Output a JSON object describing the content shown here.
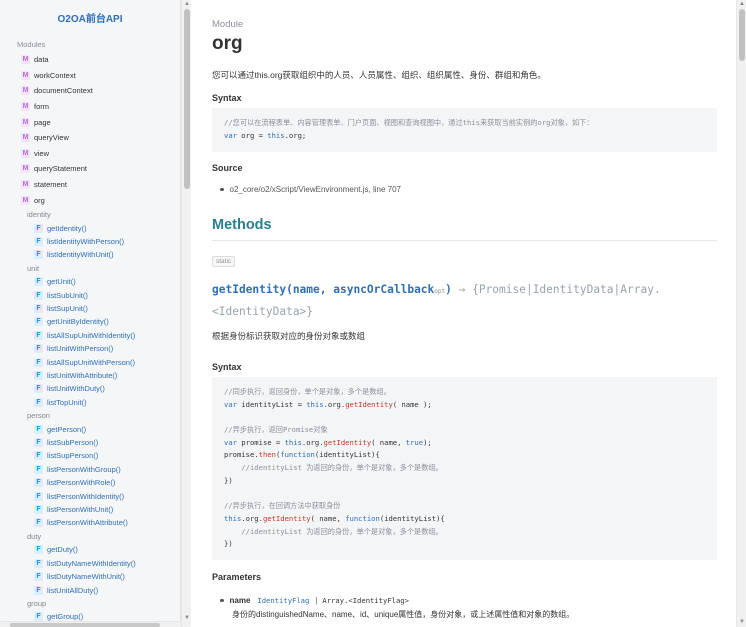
{
  "sidebar": {
    "title": "O2OA前台API",
    "modules_heading": "Modules",
    "modules": [
      "data",
      "workContext",
      "documentContext",
      "form",
      "page",
      "queryView",
      "view",
      "queryStatement",
      "statement",
      "org"
    ],
    "badge_m": "M",
    "badge_f": "F",
    "groups": [
      {
        "label": "identity",
        "items": [
          "getIdentity()",
          "listIdentityWithPerson()",
          "listIdentityWithUnit()"
        ]
      },
      {
        "label": "unit",
        "items": [
          "getUnit()",
          "listSubUnit()",
          "listSupUnit()",
          "getUnitByIdentity()",
          "listAllSupUnitWithIdentity()",
          "listUnitWithPerson()",
          "listAllSupUnitWithPerson()",
          "listUnitWithAttribute()",
          "listUnitWithDuty()",
          "listTopUnit()"
        ]
      },
      {
        "label": "person",
        "items": [
          "getPerson()",
          "listSubPerson()",
          "listSupPerson()",
          "listPersonWithGroup()",
          "listPersonWithRole()",
          "listPersonWithIdentity()",
          "listPersonWithUnit()",
          "listPersonWithAttribute()"
        ]
      },
      {
        "label": "duty",
        "items": [
          "getDuty()",
          "listDutyNameWithIdentity()",
          "listDutyNameWithUnit()",
          "listUnitAllDuty()"
        ]
      },
      {
        "label": "group",
        "items": [
          "getGroup()"
        ]
      }
    ]
  },
  "main": {
    "module_label": "Module",
    "module_name": "org",
    "description": "您可以通过this.org获取组织中的人员、人员属性、组织、组织属性、身份、群组和角色。",
    "syntax_heading": "Syntax",
    "syntax_comment": "//您可以在流程表单、内容管理表单、门户页面、视图和查询视图中，通过this来获取当前实例的org对象，如下：",
    "syntax_code": {
      "kw": "var",
      "var": " org = ",
      "this": "this",
      "rest": ".org;"
    },
    "source_heading": "Source",
    "source_text": "o2_core/o2/xScript/ViewEnvironment.js, line 707",
    "methods_heading": "Methods",
    "static_tag": "static",
    "method": {
      "name": "getIdentity(name, asyncOrCallback",
      "opt": "opt",
      "close": ")",
      "returns": " → {Promise|IdentityData|Array.<IdentityData>}",
      "description": "根据身份标识获取对应的身份对象或数组",
      "syntax_heading": "Syntax",
      "code_lines": [
        "//同步执行，返回身份，单个是对象，多个是数组。",
        "var identityList = this.org.getIdentity( name );",
        "",
        "//异步执行，返回Promise对象",
        "var promise = this.org.getIdentity( name, true);",
        "promise.then(function(identityList){",
        "    //identityList 为返回的身份，单个是对象，多个是数组。",
        "})",
        "",
        "//异步执行，在回调方法中获取身份",
        "this.org.getIdentity( name, function(identityList){",
        "    //identityList 为返回的身份，单个是对象，多个是数组。",
        "})"
      ],
      "params_heading": "Parameters",
      "param": {
        "name": "name",
        "type1": "IdentityFlag",
        "sep": "|",
        "type2": "Array.<IdentityFlag>",
        "description": "身份的distinguishedName、name、id、unique属性值，身份对象，或上述属性值和对象的数组。"
      }
    }
  },
  "colors": {
    "accent": "#2f6fb4",
    "methods_heading": "#2a7f8f",
    "badge_m": "#b96cd5",
    "badge_f": "#1f8fd6"
  }
}
